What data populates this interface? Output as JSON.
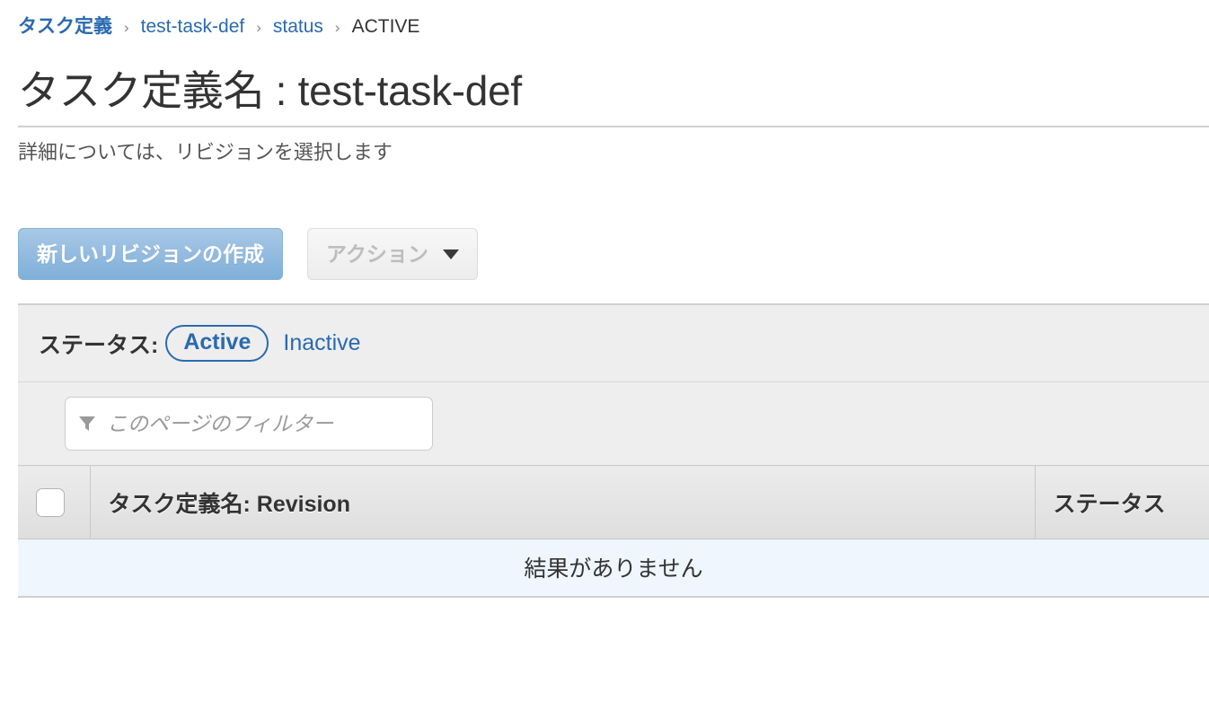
{
  "breadcrumb": {
    "separator": "›",
    "items": [
      {
        "label": "タスク定義",
        "type": "link",
        "bold": true
      },
      {
        "label": "test-task-def",
        "type": "link",
        "bold": false
      },
      {
        "label": "status",
        "type": "link",
        "bold": false
      },
      {
        "label": "ACTIVE",
        "type": "current",
        "bold": false
      }
    ]
  },
  "header": {
    "title": "タスク定義名 : test-task-def",
    "subtitle": "詳細については、リビジョンを選択します"
  },
  "toolbar": {
    "create_revision_label": "新しいリビジョンの作成",
    "actions_label": "アクション",
    "actions_caret": "caret-down-icon",
    "actions_disabled": true
  },
  "status_filter": {
    "label": "ステータス:",
    "active_label": "Active",
    "inactive_label": "Inactive",
    "selected": "Active"
  },
  "search": {
    "icon": "filter-funnel-icon",
    "placeholder": "このページのフィルター",
    "value": ""
  },
  "table": {
    "columns": [
      {
        "key": "select",
        "label": ""
      },
      {
        "key": "name_revision",
        "label": "タスク定義名: Revision"
      },
      {
        "key": "status",
        "label": "ステータス"
      }
    ],
    "rows": [],
    "empty_message": "結果がありません"
  },
  "colors": {
    "link": "#2a6ab0",
    "primary_button_top": "#a8c9e6",
    "primary_button_bottom": "#7fb0d8",
    "panel_background": "#eeeeee",
    "empty_row_background": "#eff6fd",
    "text": "#333333"
  }
}
